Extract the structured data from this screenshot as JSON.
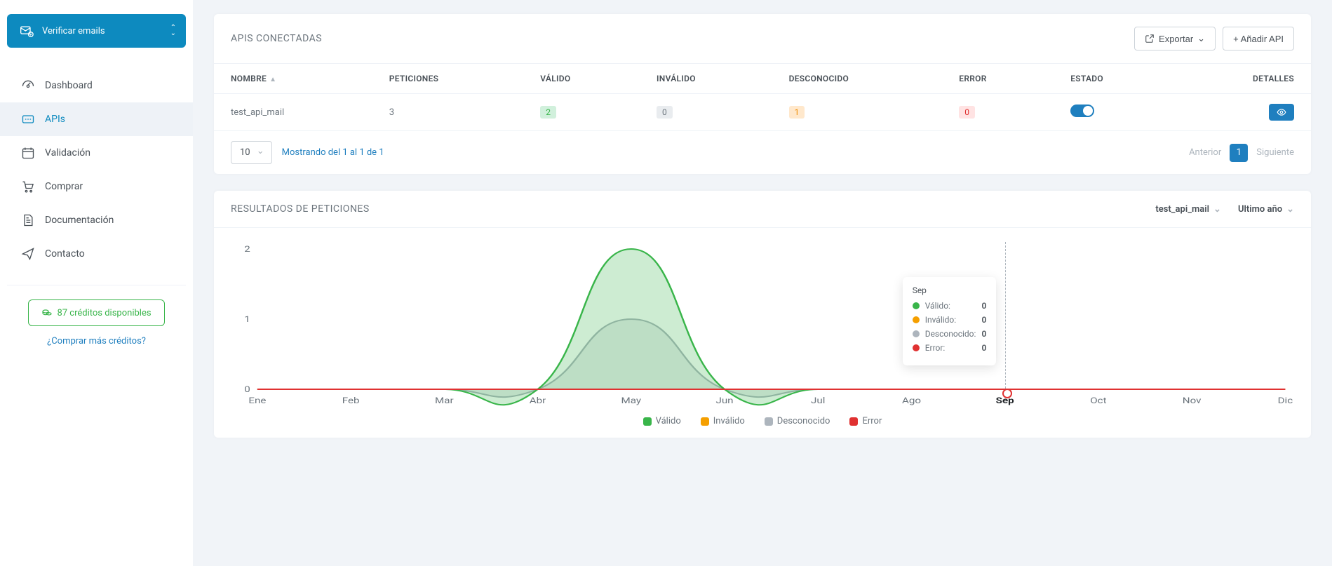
{
  "sidebar": {
    "verify_label": "Verificar emails",
    "items": [
      {
        "label": "Dashboard",
        "icon": "gauge-icon"
      },
      {
        "label": "APIs",
        "icon": "api-icon",
        "active": true
      },
      {
        "label": "Validación",
        "icon": "calendar-icon"
      },
      {
        "label": "Comprar",
        "icon": "cart-icon"
      },
      {
        "label": "Documentación",
        "icon": "document-icon"
      },
      {
        "label": "Contacto",
        "icon": "send-icon"
      }
    ],
    "credits_label": "87 créditos disponibles",
    "buy_more_label": "¿Comprar más créditos?"
  },
  "apis_card": {
    "title": "APIS CONECTADAS",
    "export_label": "Exportar",
    "add_label": "+ Añadir API",
    "columns": {
      "name": "NOMBRE",
      "requests": "PETICIONES",
      "valid": "VÁLIDO",
      "invalid": "INVÁLIDO",
      "unknown": "DESCONOCIDO",
      "error": "ERROR",
      "state": "ESTADO",
      "details": "DETALLES"
    },
    "rows": [
      {
        "name": "test_api_mail",
        "requests": "3",
        "valid": "2",
        "invalid": "0",
        "unknown": "1",
        "error": "0"
      }
    ],
    "page_size": "10",
    "showing": "Mostrando del 1 al 1 de 1",
    "prev": "Anterior",
    "page": "1",
    "next": "Siguiente"
  },
  "results_card": {
    "title": "RESULTADOS DE PETICIONES",
    "filter_api": "test_api_mail",
    "filter_range": "Ultimo año",
    "legend": {
      "valid": "Válido",
      "invalid": "Inválido",
      "unknown": "Desconocido",
      "error": "Error"
    },
    "tooltip": {
      "month": "Sep",
      "rows": [
        {
          "label": "Válido:",
          "value": "0",
          "color": "#39b54a"
        },
        {
          "label": "Inválido:",
          "value": "0",
          "color": "#f59f00"
        },
        {
          "label": "Desconocido:",
          "value": "0",
          "color": "#adb5bd"
        },
        {
          "label": "Error:",
          "value": "0",
          "color": "#e03131"
        }
      ]
    }
  },
  "colors": {
    "valid": "#39b54a",
    "invalid": "#f59f00",
    "unknown": "#adb5bd",
    "error": "#e03131"
  },
  "chart_data": {
    "type": "area",
    "x": [
      "Ene",
      "Feb",
      "Mar",
      "Abr",
      "May",
      "Jun",
      "Jul",
      "Ago",
      "Sep",
      "Oct",
      "Nov",
      "Dic"
    ],
    "series": [
      {
        "name": "Válido",
        "color": "#39b54a",
        "values": [
          0,
          0,
          0,
          0,
          2,
          0,
          0,
          0,
          0,
          0,
          0,
          0
        ]
      },
      {
        "name": "Inválido",
        "color": "#f59f00",
        "values": [
          0,
          0,
          0,
          0,
          0,
          0,
          0,
          0,
          0,
          0,
          0,
          0
        ]
      },
      {
        "name": "Desconocido",
        "color": "#adb5bd",
        "values": [
          0,
          0,
          0,
          0,
          1,
          0,
          0,
          0,
          0,
          0,
          0,
          0
        ]
      },
      {
        "name": "Error",
        "color": "#e03131",
        "values": [
          0,
          0,
          0,
          0,
          0,
          0,
          0,
          0,
          0,
          0,
          0,
          0
        ]
      }
    ],
    "ylim": [
      0,
      2
    ],
    "yticks": [
      0,
      1,
      2
    ],
    "xlabel": "",
    "ylabel": "",
    "highlight_x": "Sep"
  }
}
